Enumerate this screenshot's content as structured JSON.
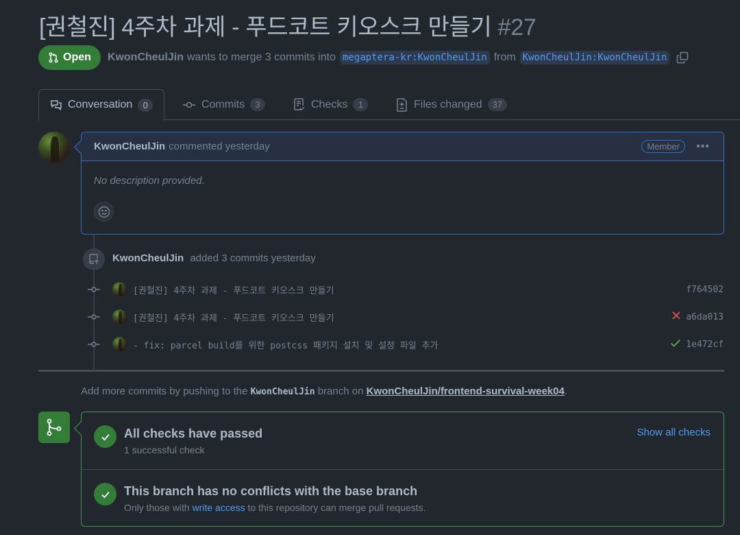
{
  "pr": {
    "title": "[권철진] 4주차 과제 - 푸드코트 키오스크 만들기",
    "number": "#27",
    "state": "Open",
    "author": "KwonCheulJin",
    "merge_text": "wants to merge 3 commits into",
    "base_branch": "megaptera-kr:KwonCheulJin",
    "from_text": "from",
    "head_branch": "KwonCheulJin:KwonCheulJin"
  },
  "tabs": [
    {
      "label": "Conversation",
      "count": "0",
      "icon": "comment-discussion-icon"
    },
    {
      "label": "Commits",
      "count": "3",
      "icon": "commit-icon"
    },
    {
      "label": "Checks",
      "count": "1",
      "icon": "checklist-icon"
    },
    {
      "label": "Files changed",
      "count": "37",
      "icon": "file-diff-icon"
    }
  ],
  "comment": {
    "author": "KwonCheulJin",
    "action": "commented yesterday",
    "badge": "Member",
    "body": "No description provided."
  },
  "commits_event": {
    "author": "KwonCheulJin",
    "text": "added 3 commits yesterday",
    "commits": [
      {
        "message": "[권철진] 4주차 과제 - 푸드코트 키오스크 만들기",
        "sha": "f764502",
        "status": ""
      },
      {
        "message": "[권철진] 4주차 과제 - 푸드코트 키오스크 만들기",
        "sha": "a6da013",
        "status": "failure"
      },
      {
        "message": "- fix: parcel build를 위한 postcss 패키지 설치 및 설정 파일 추가",
        "sha": "1e472cf",
        "status": "success"
      }
    ]
  },
  "push_note": {
    "prefix": "Add more commits by pushing to the",
    "branch": "KwonCheulJin",
    "middle": "branch on",
    "repo": "KwonCheulJin/frontend-survival-week04",
    "suffix": "."
  },
  "merge": {
    "checks_title": "All checks have passed",
    "checks_sub": "1 successful check",
    "show_all": "Show all checks",
    "conflicts_title": "This branch has no conflicts with the base branch",
    "conflicts_sub_prefix": "Only those with",
    "conflicts_link": "write access",
    "conflicts_sub_suffix": "to this repository can merge pull requests."
  },
  "colors": {
    "open_green": "#347d39",
    "link_blue": "#539bf5",
    "failure_red": "#e5534b",
    "success_green": "#57ab5a"
  }
}
